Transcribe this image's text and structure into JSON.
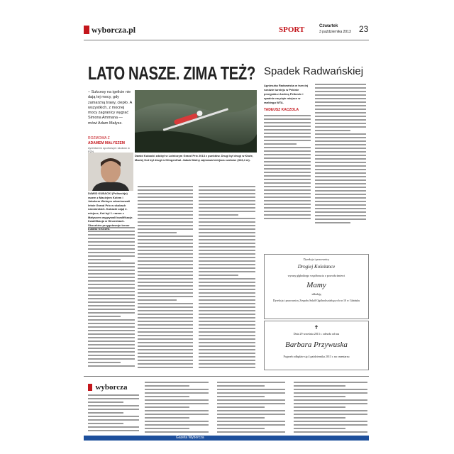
{
  "header": {
    "brand": "wyborcza.pl",
    "section": "SPORT",
    "weekday": "Czwartek",
    "date": "3 października 2013",
    "page": "23"
  },
  "article": {
    "headline": "LATO NASZE. ZIMA TEŻ?",
    "sidebar_quote": "– Sukcesy na igelicie nie dają tej mocy, gdy zamarzną trawy, ciepło. A wszystkich, z mocnej mocy zagranicy wygrać Simona Ammana — mówi Adam Małysz.",
    "byline_label": "ROZMOWA Z",
    "byline_name": "ADAMEM MAŁYSZEM",
    "byline_sub": "dyrektorem sportowym skoków w PZN",
    "photo_caption": "Dawid Kubacki zdobył w Lotniczym Grand Prix 2013 z punktów. Drugi był drugi w Kiwie, Maciej Kot był drugi w Klingenthal. Jakub Wolny zajmował miejsca czołowe (323,4 m).",
    "lead_bold": "DAWID KUBACKI (Poliarchja) razem z Maciejem Kotem i Jakubem Wolnym zdominowali letnie Grand Prix w skokach narciarskich. Kubacki zajął 2. miejsce, Kot był 1. razem z Małyszem wygrywali kwalifikacje. Kwalifikacja w Hinzenbach. Skoczków przygotowuje trener Łukasz Kruczek."
  },
  "second_article": {
    "headline": "Spadek Radwańskiej",
    "lead": "Agnieszka Radwańska w trzeciej rundzie turnieju w Pekinie przegrała z Andreą Petkovic i spadnie na piąte miejsce w rankingu WTA.",
    "author": "TADEUSZ KACZOLA"
  },
  "obituaries": [
    {
      "intro": "Dyrekcja i pracownicy",
      "name_top": "Drogiej Koleżance",
      "condolence": "wyrazy głębokiego współczucia z powodu śmierci",
      "name": "Mamy",
      "closing": "składają",
      "footer": "Dyrekcja i pracownicy Zespołu Szkół Ogólnokształcących nr 10 w Gdańsku"
    },
    {
      "intro": "Dnia 29 września 2013 r. odeszła od nas",
      "name": "Barbara Przywuska",
      "footer": "Pogrzeb odbędzie się 4 października 2013 r. na cmentarzu"
    }
  ],
  "colophon": {
    "logo": "wyborcza",
    "footer_bar": "Gazeta Wyborcza"
  },
  "colors": {
    "accent_red": "#c4161c",
    "text": "#222222"
  }
}
